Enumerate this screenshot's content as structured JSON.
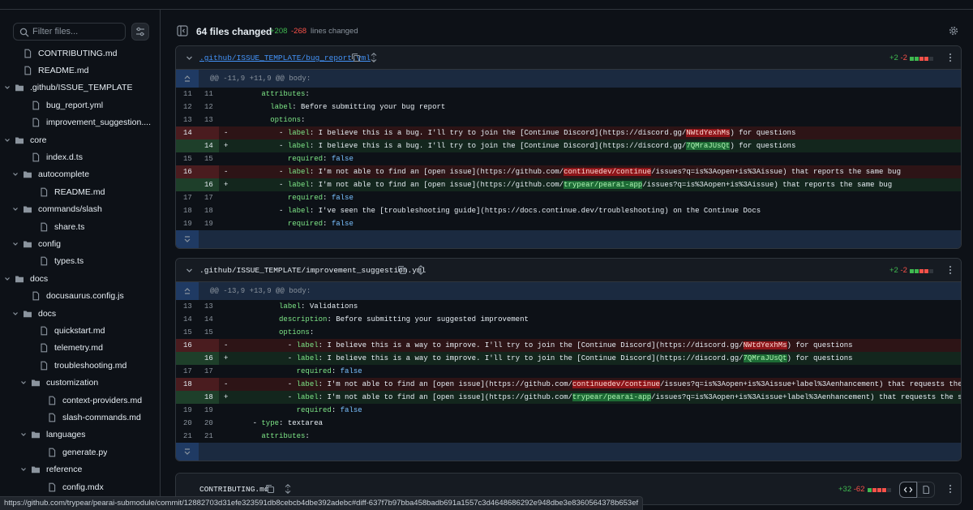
{
  "sidebar": {
    "filter_placeholder": "Filter files...",
    "items": [
      {
        "label": "CONTRIBUTING.md",
        "type": "file",
        "depth": 1
      },
      {
        "label": "README.md",
        "type": "file",
        "depth": 1
      },
      {
        "label": ".github/ISSUE_TEMPLATE",
        "type": "folder",
        "depth": 0
      },
      {
        "label": "bug_report.yml",
        "type": "file",
        "depth": 2
      },
      {
        "label": "improvement_suggestion....",
        "type": "file",
        "depth": 2
      },
      {
        "label": "core",
        "type": "folder",
        "depth": 0
      },
      {
        "label": "index.d.ts",
        "type": "file",
        "depth": 2
      },
      {
        "label": "autocomplete",
        "type": "folder",
        "depth": 1
      },
      {
        "label": "README.md",
        "type": "file",
        "depth": 3
      },
      {
        "label": "commands/slash",
        "type": "folder",
        "depth": 1
      },
      {
        "label": "share.ts",
        "type": "file",
        "depth": 3
      },
      {
        "label": "config",
        "type": "folder",
        "depth": 1
      },
      {
        "label": "types.ts",
        "type": "file",
        "depth": 3
      },
      {
        "label": "docs",
        "type": "folder",
        "depth": 0
      },
      {
        "label": "docusaurus.config.js",
        "type": "file",
        "depth": 2
      },
      {
        "label": "docs",
        "type": "folder",
        "depth": 1
      },
      {
        "label": "quickstart.md",
        "type": "file",
        "depth": 3
      },
      {
        "label": "telemetry.md",
        "type": "file",
        "depth": 3
      },
      {
        "label": "troubleshooting.md",
        "type": "file",
        "depth": 3
      },
      {
        "label": "customization",
        "type": "folder",
        "depth": 2
      },
      {
        "label": "context-providers.md",
        "type": "file",
        "depth": 4
      },
      {
        "label": "slash-commands.md",
        "type": "file",
        "depth": 4
      },
      {
        "label": "languages",
        "type": "folder",
        "depth": 2
      },
      {
        "label": "generate.py",
        "type": "file",
        "depth": 4
      },
      {
        "label": "reference",
        "type": "folder",
        "depth": 2
      },
      {
        "label": "config.mdx",
        "type": "file",
        "depth": 4
      }
    ]
  },
  "toolbar": {
    "files_changed": "64 files changed",
    "additions": "+208",
    "deletions": "-268",
    "lines_changed": "lines changed"
  },
  "files": [
    {
      "name": ".github/ISSUE_TEMPLATE/bug_report.yml",
      "additions": "+2",
      "deletions": "-2",
      "hunk": "@@ -11,9 +11,9 @@ body:",
      "rows": [
        {
          "t": "ctx",
          "o": "11",
          "n": "11",
          "s": "",
          "code": "      attributes:"
        },
        {
          "t": "ctx",
          "o": "12",
          "n": "12",
          "s": "",
          "code": "        label: Before submitting your bug report"
        },
        {
          "t": "ctx",
          "o": "13",
          "n": "13",
          "s": "",
          "code": "        options:"
        },
        {
          "t": "del",
          "o": "14",
          "n": "",
          "s": "-",
          "code": "          - label: I believe this is a bug. I'll try to join the [Continue Discord](https://discord.gg/NWtdYexhMs) for questions"
        },
        {
          "t": "add",
          "o": "",
          "n": "14",
          "s": "+",
          "code": "          - label: I believe this is a bug. I'll try to join the [Continue Discord](https://discord.gg/7QMraJUsQt) for questions"
        },
        {
          "t": "ctx",
          "o": "15",
          "n": "15",
          "s": "",
          "code": "            required: false"
        },
        {
          "t": "del",
          "o": "16",
          "n": "",
          "s": "-",
          "code": "          - label: I'm not able to find an [open issue](https://github.com/continuedev/continue/issues?q=is%3Aopen+is%3Aissue) that reports the same bug"
        },
        {
          "t": "add",
          "o": "",
          "n": "16",
          "s": "+",
          "code": "          - label: I'm not able to find an [open issue](https://github.com/trypear/pearai-app/issues?q=is%3Aopen+is%3Aissue) that reports the same bug"
        },
        {
          "t": "ctx",
          "o": "17",
          "n": "17",
          "s": "",
          "code": "            required: false"
        },
        {
          "t": "ctx",
          "o": "18",
          "n": "18",
          "s": "",
          "code": "          - label: I've seen the [troubleshooting guide](https://docs.continue.dev/troubleshooting) on the Continue Docs"
        },
        {
          "t": "ctx",
          "o": "19",
          "n": "19",
          "s": "",
          "code": "            required: false"
        }
      ]
    },
    {
      "name": ".github/ISSUE_TEMPLATE/improvement_suggestion.yml",
      "additions": "+2",
      "deletions": "-2",
      "hunk": "@@ -13,9 +13,9 @@ body:",
      "rows": [
        {
          "t": "ctx",
          "o": "13",
          "n": "13",
          "s": "",
          "code": "          label: Validations"
        },
        {
          "t": "ctx",
          "o": "14",
          "n": "14",
          "s": "",
          "code": "          description: Before submitting your suggested improvement"
        },
        {
          "t": "ctx",
          "o": "15",
          "n": "15",
          "s": "",
          "code": "          options:"
        },
        {
          "t": "del",
          "o": "16",
          "n": "",
          "s": "-",
          "code": "            - label: I believe this is a way to improve. I'll try to join the [Continue Discord](https://discord.gg/NWtdYexhMs) for questions"
        },
        {
          "t": "add",
          "o": "",
          "n": "16",
          "s": "+",
          "code": "            - label: I believe this is a way to improve. I'll try to join the [Continue Discord](https://discord.gg/7QMraJUsQt) for questions"
        },
        {
          "t": "ctx",
          "o": "17",
          "n": "17",
          "s": "",
          "code": "              required: false"
        },
        {
          "t": "del",
          "o": "18",
          "n": "",
          "s": "-",
          "code": "            - label: I'm not able to find an [open issue](https://github.com/continuedev/continue/issues?q=is%3Aopen+is%3Aissue+label%3Aenhancement) that requests the same enhancement"
        },
        {
          "t": "add",
          "o": "",
          "n": "18",
          "s": "+",
          "code": "            - label: I'm not able to find an [open issue](https://github.com/trypear/pearai-app/issues?q=is%3Aopen+is%3Aissue+label%3Aenhancement) that requests the same enhancement"
        },
        {
          "t": "ctx",
          "o": "19",
          "n": "19",
          "s": "",
          "code": "              required: false"
        },
        {
          "t": "ctx",
          "o": "20",
          "n": "20",
          "s": "",
          "code": "    - type: textarea"
        },
        {
          "t": "ctx",
          "o": "21",
          "n": "21",
          "s": "",
          "code": "      attributes:"
        }
      ]
    },
    {
      "name": "CONTRIBUTING.md",
      "additions": "+32",
      "deletions": "-62"
    }
  ],
  "highlights": {
    "del": [
      "NWtdYexhMs",
      "continuedev/continue"
    ],
    "add": [
      "7QMraJUsQt",
      "trypear/pearai-app"
    ]
  },
  "status_url": "https://github.com/trypear/pearai-submodule/commit/12882703d31efe323591db8cebcb4dbe392adebc#diff-637f7b97bba458badb691a1557c3d4648686292e948dbe3e8360564378b653ef",
  "colors": {
    "background": "#0d1117",
    "addition": "#3fb950",
    "deletion": "#f85149",
    "link": "#4493f8"
  }
}
